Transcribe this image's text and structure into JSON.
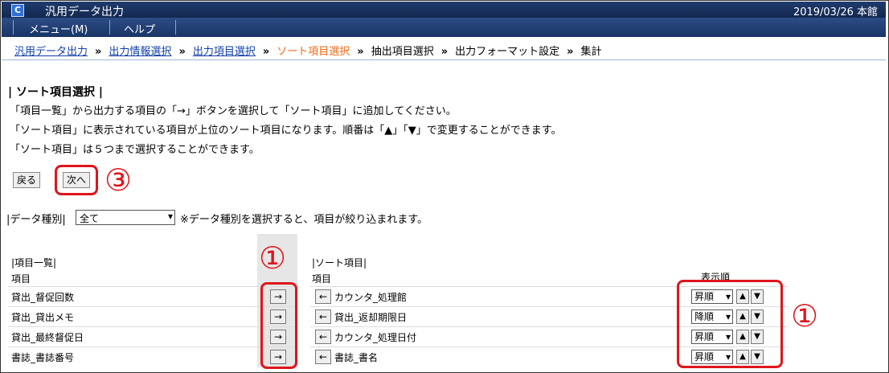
{
  "window": {
    "title": "汎用データ出力",
    "date_location": "2019/03/26 本館",
    "logo": "C"
  },
  "menu": {
    "items": [
      "メニュー(M)",
      "ヘルプ"
    ]
  },
  "breadcrumb": {
    "steps": [
      "汎用データ出力",
      "出力情報選択",
      "出力項目選択",
      "ソート項目選択",
      "抽出項目選択",
      "出力フォーマット設定",
      "集計"
    ],
    "separator": "»"
  },
  "section": {
    "title": "| ソート項目選択 |"
  },
  "instructions": [
    "「項目一覧」から出力する項目の「→」ボタンを選択して「ソート項目」に追加してください。",
    "「ソート項目」に表示されている項目が上位のソート項目になります。順番は「▲」「▼」で変更することができます。",
    "「ソート項目」は５つまで選択することができます。"
  ],
  "buttons": {
    "back": "戻る",
    "next": "次へ"
  },
  "annotations": {
    "circle1": "①",
    "circle3": "③"
  },
  "filter": {
    "label": "|データ種別|",
    "value": "全て",
    "note": "※データ種別を選択すると、項目が絞り込まれます。"
  },
  "item_list": {
    "label": "|項目一覧|",
    "header": "項目",
    "rows": [
      "貸出_督促回数",
      "貸出_貸出メモ",
      "貸出_最終督促日",
      "書誌_書誌番号"
    ],
    "add_symbol": "→"
  },
  "sort_list": {
    "label": "|ソート項目|",
    "header": "項目",
    "order_header": "表示順",
    "remove_symbol": "←",
    "up_symbol": "▲",
    "down_symbol": "▼",
    "rows": [
      {
        "name": "カウンタ_処理館",
        "order": "昇順"
      },
      {
        "name": "貸出_返却期限日",
        "order": "降順"
      },
      {
        "name": "カウンタ_処理日付",
        "order": "昇順"
      },
      {
        "name": "書誌_書名",
        "order": "昇順"
      }
    ]
  },
  "colors": {
    "titlebar": "#1f3b6e",
    "link": "#1140a8",
    "current_step": "#ef6a17",
    "highlight": "#e0151c"
  }
}
